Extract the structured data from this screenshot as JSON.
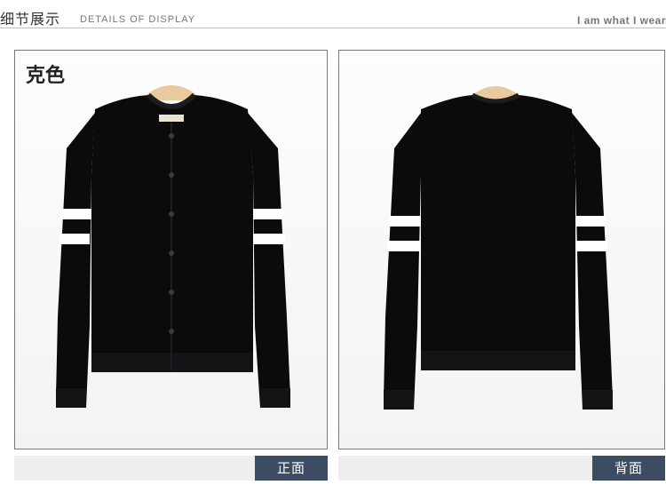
{
  "header": {
    "title_cn": "细节展示",
    "title_en": "DETAILS OF DISPLAY",
    "slogan": "I am what I wear"
  },
  "front_panel": {
    "color_label": "克色",
    "tag": "正面"
  },
  "back_panel": {
    "tag": "背面"
  },
  "colors": {
    "garment": "#0b0b0c",
    "stripe": "#ffffff",
    "tag_bg": "#3b4c63",
    "hanger": "#e8c9a0"
  }
}
